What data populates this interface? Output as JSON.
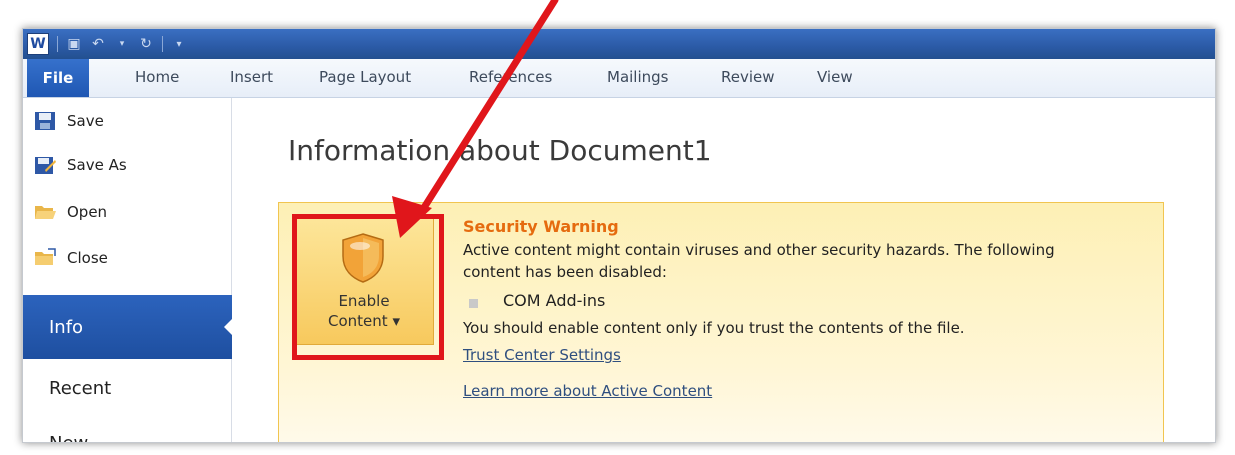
{
  "qat": {
    "word_icon": "W",
    "icons": [
      "save-icon",
      "undo-icon",
      "redo-icon",
      "customize-icon"
    ]
  },
  "ribbon": {
    "tabs": [
      "File",
      "Home",
      "Insert",
      "Page Layout",
      "References",
      "Mailings",
      "Review",
      "View"
    ]
  },
  "sidebar": {
    "items": [
      "Save",
      "Save As",
      "Open",
      "Close"
    ],
    "active": "Info",
    "recent": "Recent",
    "new": "New"
  },
  "main": {
    "title": "Information about Document1",
    "warning": {
      "title": "Security Warning",
      "line1": "Active content might contain viruses and other security hazards. The following",
      "line2": "content has been disabled:",
      "bullet": "COM Add-ins",
      "line3": "You should enable content only if you trust the contents of the file.",
      "link1": "Trust Center Settings",
      "link2": "Learn more about Active Content"
    },
    "button": {
      "line1": "Enable",
      "line2": "Content ▾"
    }
  },
  "colors": {
    "accent_red": "#e0161b",
    "warning_orange": "#e56b0f",
    "file_blue": "#1f57b3"
  }
}
